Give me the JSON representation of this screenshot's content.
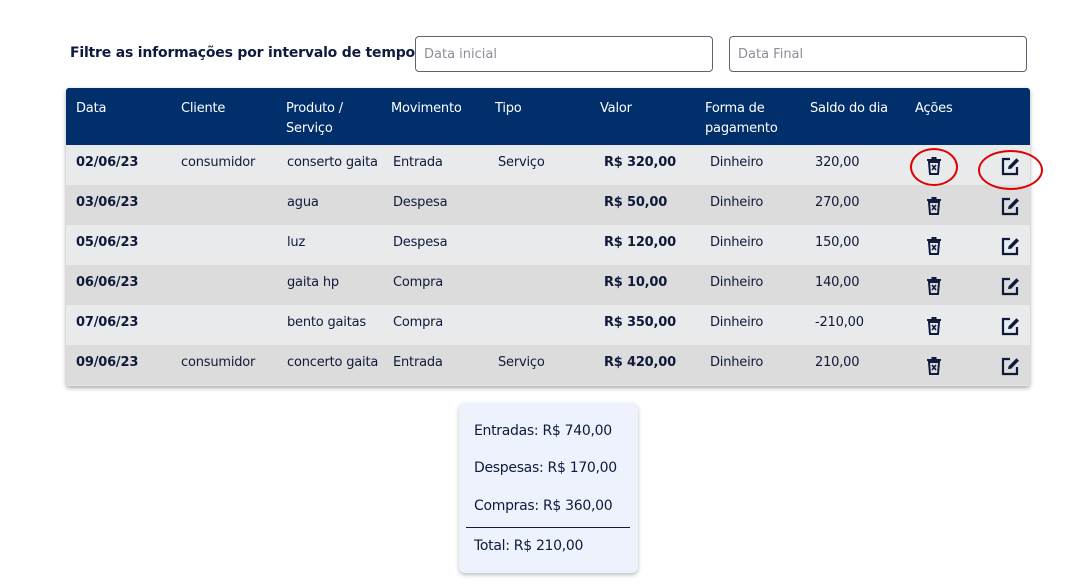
{
  "filter": {
    "label": "Filtre as informações por intervalo de tempo:",
    "start_placeholder": "Data inicial",
    "end_placeholder": "Data Final"
  },
  "table": {
    "headers": {
      "data": "Data",
      "cliente": "Cliente",
      "produto_l1": "Produto /",
      "produto_l2": "Serviço",
      "movimento": "Movimento",
      "tipo": "Tipo",
      "valor": "Valor",
      "forma_l1": "Forma de",
      "forma_l2": "pagamento",
      "saldo": "Saldo do dia",
      "acoes": "Ações"
    },
    "rows": [
      {
        "data": "02/06/23",
        "cliente": "consumidor",
        "produto": "conserto gaita",
        "movimento": "Entrada",
        "tipo": "Serviço",
        "valor": "R$ 320,00",
        "forma": "Dinheiro",
        "saldo": "320,00"
      },
      {
        "data": "03/06/23",
        "cliente": "",
        "produto": "agua",
        "movimento": "Despesa",
        "tipo": "",
        "valor": "R$ 50,00",
        "forma": "Dinheiro",
        "saldo": "270,00"
      },
      {
        "data": "05/06/23",
        "cliente": "",
        "produto": "luz",
        "movimento": "Despesa",
        "tipo": "",
        "valor": "R$ 120,00",
        "forma": "Dinheiro",
        "saldo": "150,00"
      },
      {
        "data": "06/06/23",
        "cliente": "",
        "produto": "gaita hp",
        "movimento": "Compra",
        "tipo": "",
        "valor": "R$ 10,00",
        "forma": "Dinheiro",
        "saldo": "140,00"
      },
      {
        "data": "07/06/23",
        "cliente": "",
        "produto": "bento gaitas",
        "movimento": "Compra",
        "tipo": "",
        "valor": "R$ 350,00",
        "forma": "Dinheiro",
        "saldo": "-210,00"
      },
      {
        "data": "09/06/23",
        "cliente": "consumidor",
        "produto": "concerto gaita",
        "movimento": "Entrada",
        "tipo": "Serviço",
        "valor": "R$ 420,00",
        "forma": "Dinheiro",
        "saldo": "210,00"
      }
    ],
    "delete_icon": "trash-icon",
    "edit_icon": "edit-icon"
  },
  "summary": {
    "entradas": "Entradas: R$ 740,00",
    "despesas": "Despesas: R$ 170,00",
    "compras": "Compras: R$ 360,00",
    "total": "Total: R$ 210,00"
  },
  "colors": {
    "header_bg": "#012f6c",
    "highlight": "#e00000",
    "summary_bg": "#edf2fc"
  }
}
